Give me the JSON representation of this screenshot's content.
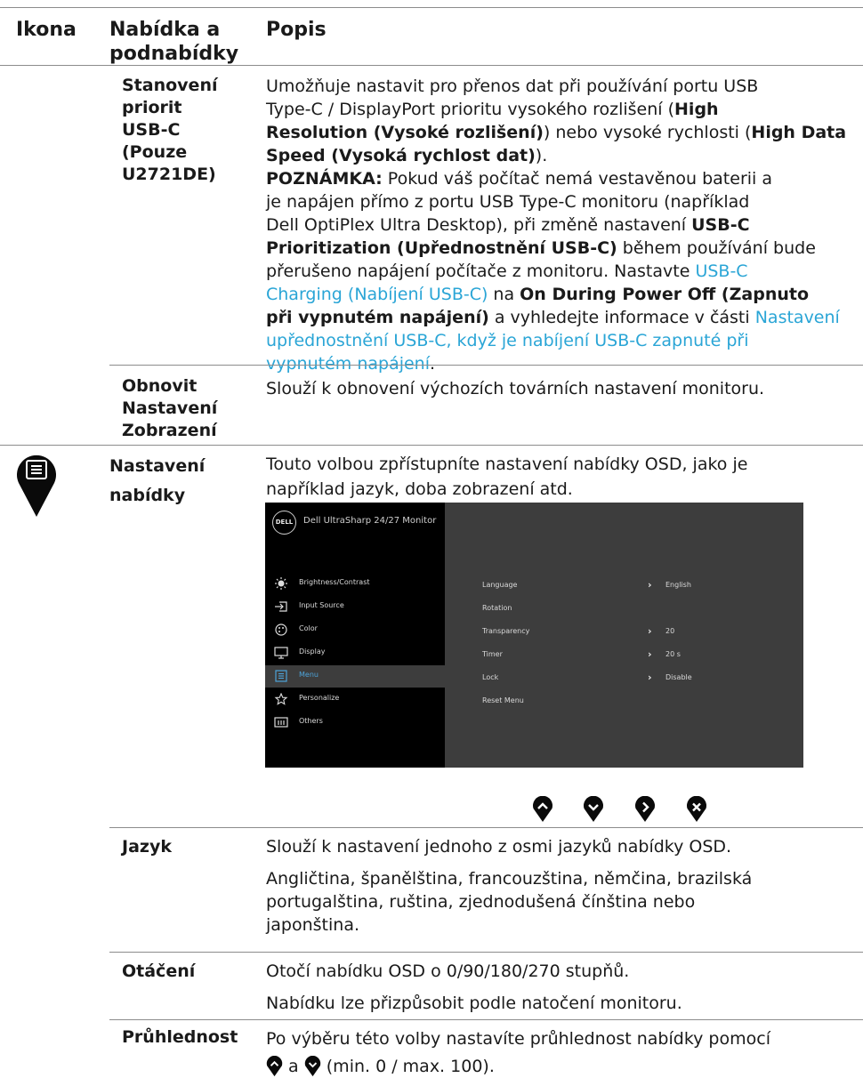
{
  "header": {
    "col_icon": "Ikona",
    "col_menu_line1": "Nabídka a",
    "col_menu_line2": "podnabídky",
    "col_desc": "Popis"
  },
  "usbc": {
    "menu_lines": [
      "Stanovení",
      "priorit",
      "USB-C",
      "(Pouze",
      "U2721DE)"
    ],
    "desc_line1": "Umožňuje nastavit pro přenos dat při používání portu USB",
    "desc_line2": "Type-C / DisplayPort prioritu vysokého rozlišení (",
    "desc_line2_b": "High",
    "desc_line3_b": "Resolution (Vysoké rozlišení)",
    "desc_line3": ") nebo vysoké rychlosti (",
    "desc_line3_b2": "High Data",
    "desc_line4_b": "Speed (Vysoká rychlost dat)",
    "desc_line4": ").",
    "note_label": "POZNÁMKA:",
    "note_line1": " Pokud váš počítač nemá vestavěnou baterii a",
    "note_line2": "je napájen přímo z portu USB Type-C monitoru (například",
    "note_line3": "Dell OptiPlex Ultra Desktop), při změně nastavení ",
    "note_line3_b": "USB-C",
    "note_line4_b": "Prioritization (Upřednostnění USB-C)",
    "note_line4": " během používání bude",
    "note_line5": "přerušeno napájení počítače z monitoru. Nastavte ",
    "note_line5_link": "USB-C",
    "note_line6_link": "Charging (Nabíjení USB-C)",
    "note_line6": " na ",
    "note_line6_b": "On During Power Off (Zapnuto",
    "note_line7_b": "při vypnutém napájení)",
    "note_line7": " a vyhledejte informace v části ",
    "note_line7_link": "Nastavení",
    "note_line8_link": "upřednostnění USB-C, když je nabíjení USB-C zapnuté při",
    "note_line9_link": "vypnutém napájení",
    "note_line9": "."
  },
  "reset": {
    "menu_lines": [
      "Obnovit",
      "Nastavení",
      "Zobrazení"
    ],
    "desc": "Slouží k obnovení výchozích továrních nastavení monitoru."
  },
  "menu_settings": {
    "menu_lines": [
      "Nastavení",
      "nabídky"
    ],
    "desc_line1": "Touto volbou zpřístupníte nastavení nabídky OSD, jako je",
    "desc_line2": "například jazyk, doba zobrazení atd."
  },
  "osd": {
    "brand": "DELL",
    "title": "Dell UltraSharp 24/27 Monitor",
    "items": [
      {
        "label": "Brightness/Contrast",
        "icon": "brightness-icon"
      },
      {
        "label": "Input Source",
        "icon": "input-source-icon"
      },
      {
        "label": "Color",
        "icon": "color-icon"
      },
      {
        "label": "Display",
        "icon": "display-icon"
      },
      {
        "label": "Menu",
        "icon": "menu-icon",
        "selected": true
      },
      {
        "label": "Personalize",
        "icon": "star-icon"
      },
      {
        "label": "Others",
        "icon": "others-icon"
      }
    ],
    "submenu": [
      {
        "label": "Language",
        "value": "English"
      },
      {
        "label": "Rotation",
        "value": ""
      },
      {
        "label": "Transparency",
        "value": "20"
      },
      {
        "label": "Timer",
        "value": "20 s"
      },
      {
        "label": "Lock",
        "value": "Disable"
      },
      {
        "label": "Reset Menu",
        "value": ""
      }
    ]
  },
  "nav_buttons": [
    "up-icon",
    "down-icon",
    "right-icon",
    "close-icon"
  ],
  "language": {
    "menu": "Jazyk",
    "desc1": "Slouží k nastavení jednoho z osmi jazyků nabídky OSD.",
    "desc2_line1": "Angličtina, španělština, francouzština, němčina, brazilská",
    "desc2_line2": "portugalština, ruština, zjednodušená čínština nebo",
    "desc2_line3": "japonština."
  },
  "rotation": {
    "menu": "Otáčení",
    "desc1": "Otočí nabídku OSD o 0/90/180/270 stupňů.",
    "desc2": "Nabídku lze přizpůsobit podle natočení monitoru."
  },
  "transparency": {
    "menu": "Průhlednost",
    "desc_line1": "Po výběru této volby nastavíte průhlednost nabídky pomocí",
    "desc_line2_mid": " a ",
    "desc_line2_end": " (min. 0 / max. 100)."
  },
  "colors": {
    "link": "#2aa5d6",
    "osd_highlight": "#4da3d9",
    "osd_bg": "#3d3d3d"
  }
}
